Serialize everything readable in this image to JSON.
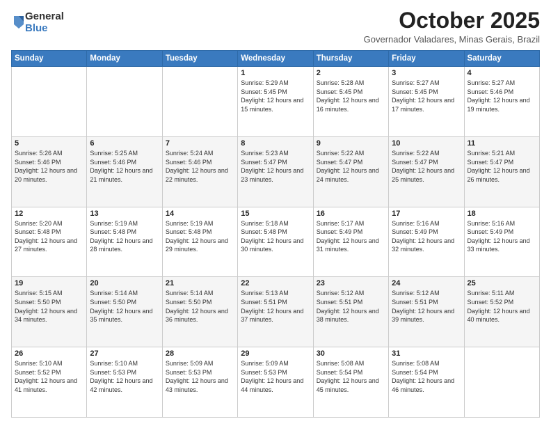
{
  "logo": {
    "general": "General",
    "blue": "Blue"
  },
  "header": {
    "month": "October 2025",
    "location": "Governador Valadares, Minas Gerais, Brazil"
  },
  "weekdays": [
    "Sunday",
    "Monday",
    "Tuesday",
    "Wednesday",
    "Thursday",
    "Friday",
    "Saturday"
  ],
  "weeks": [
    [
      {
        "day": "",
        "info": ""
      },
      {
        "day": "",
        "info": ""
      },
      {
        "day": "",
        "info": ""
      },
      {
        "day": "1",
        "info": "Sunrise: 5:29 AM\nSunset: 5:45 PM\nDaylight: 12 hours\nand 15 minutes."
      },
      {
        "day": "2",
        "info": "Sunrise: 5:28 AM\nSunset: 5:45 PM\nDaylight: 12 hours\nand 16 minutes."
      },
      {
        "day": "3",
        "info": "Sunrise: 5:27 AM\nSunset: 5:45 PM\nDaylight: 12 hours\nand 17 minutes."
      },
      {
        "day": "4",
        "info": "Sunrise: 5:27 AM\nSunset: 5:46 PM\nDaylight: 12 hours\nand 19 minutes."
      }
    ],
    [
      {
        "day": "5",
        "info": "Sunrise: 5:26 AM\nSunset: 5:46 PM\nDaylight: 12 hours\nand 20 minutes."
      },
      {
        "day": "6",
        "info": "Sunrise: 5:25 AM\nSunset: 5:46 PM\nDaylight: 12 hours\nand 21 minutes."
      },
      {
        "day": "7",
        "info": "Sunrise: 5:24 AM\nSunset: 5:46 PM\nDaylight: 12 hours\nand 22 minutes."
      },
      {
        "day": "8",
        "info": "Sunrise: 5:23 AM\nSunset: 5:47 PM\nDaylight: 12 hours\nand 23 minutes."
      },
      {
        "day": "9",
        "info": "Sunrise: 5:22 AM\nSunset: 5:47 PM\nDaylight: 12 hours\nand 24 minutes."
      },
      {
        "day": "10",
        "info": "Sunrise: 5:22 AM\nSunset: 5:47 PM\nDaylight: 12 hours\nand 25 minutes."
      },
      {
        "day": "11",
        "info": "Sunrise: 5:21 AM\nSunset: 5:47 PM\nDaylight: 12 hours\nand 26 minutes."
      }
    ],
    [
      {
        "day": "12",
        "info": "Sunrise: 5:20 AM\nSunset: 5:48 PM\nDaylight: 12 hours\nand 27 minutes."
      },
      {
        "day": "13",
        "info": "Sunrise: 5:19 AM\nSunset: 5:48 PM\nDaylight: 12 hours\nand 28 minutes."
      },
      {
        "day": "14",
        "info": "Sunrise: 5:19 AM\nSunset: 5:48 PM\nDaylight: 12 hours\nand 29 minutes."
      },
      {
        "day": "15",
        "info": "Sunrise: 5:18 AM\nSunset: 5:48 PM\nDaylight: 12 hours\nand 30 minutes."
      },
      {
        "day": "16",
        "info": "Sunrise: 5:17 AM\nSunset: 5:49 PM\nDaylight: 12 hours\nand 31 minutes."
      },
      {
        "day": "17",
        "info": "Sunrise: 5:16 AM\nSunset: 5:49 PM\nDaylight: 12 hours\nand 32 minutes."
      },
      {
        "day": "18",
        "info": "Sunrise: 5:16 AM\nSunset: 5:49 PM\nDaylight: 12 hours\nand 33 minutes."
      }
    ],
    [
      {
        "day": "19",
        "info": "Sunrise: 5:15 AM\nSunset: 5:50 PM\nDaylight: 12 hours\nand 34 minutes."
      },
      {
        "day": "20",
        "info": "Sunrise: 5:14 AM\nSunset: 5:50 PM\nDaylight: 12 hours\nand 35 minutes."
      },
      {
        "day": "21",
        "info": "Sunrise: 5:14 AM\nSunset: 5:50 PM\nDaylight: 12 hours\nand 36 minutes."
      },
      {
        "day": "22",
        "info": "Sunrise: 5:13 AM\nSunset: 5:51 PM\nDaylight: 12 hours\nand 37 minutes."
      },
      {
        "day": "23",
        "info": "Sunrise: 5:12 AM\nSunset: 5:51 PM\nDaylight: 12 hours\nand 38 minutes."
      },
      {
        "day": "24",
        "info": "Sunrise: 5:12 AM\nSunset: 5:51 PM\nDaylight: 12 hours\nand 39 minutes."
      },
      {
        "day": "25",
        "info": "Sunrise: 5:11 AM\nSunset: 5:52 PM\nDaylight: 12 hours\nand 40 minutes."
      }
    ],
    [
      {
        "day": "26",
        "info": "Sunrise: 5:10 AM\nSunset: 5:52 PM\nDaylight: 12 hours\nand 41 minutes."
      },
      {
        "day": "27",
        "info": "Sunrise: 5:10 AM\nSunset: 5:53 PM\nDaylight: 12 hours\nand 42 minutes."
      },
      {
        "day": "28",
        "info": "Sunrise: 5:09 AM\nSunset: 5:53 PM\nDaylight: 12 hours\nand 43 minutes."
      },
      {
        "day": "29",
        "info": "Sunrise: 5:09 AM\nSunset: 5:53 PM\nDaylight: 12 hours\nand 44 minutes."
      },
      {
        "day": "30",
        "info": "Sunrise: 5:08 AM\nSunset: 5:54 PM\nDaylight: 12 hours\nand 45 minutes."
      },
      {
        "day": "31",
        "info": "Sunrise: 5:08 AM\nSunset: 5:54 PM\nDaylight: 12 hours\nand 46 minutes."
      },
      {
        "day": "",
        "info": ""
      }
    ]
  ]
}
